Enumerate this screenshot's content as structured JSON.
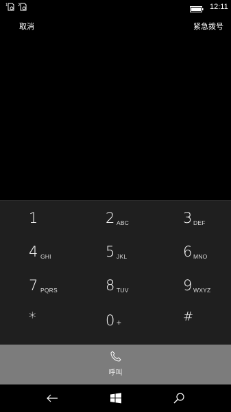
{
  "status_bar": {
    "sim1_icon": "sim-1-icon",
    "sim2_icon": "sim-2-icon",
    "battery_icon": "battery-icon",
    "time": "12:11"
  },
  "top_actions": {
    "cancel_label": "取消",
    "emergency_label": "紧急拨号"
  },
  "keypad": {
    "keys": [
      {
        "digit": "1",
        "letters": ""
      },
      {
        "digit": "2",
        "letters": "ABC"
      },
      {
        "digit": "3",
        "letters": "DEF"
      },
      {
        "digit": "4",
        "letters": "GHI"
      },
      {
        "digit": "5",
        "letters": "JKL"
      },
      {
        "digit": "6",
        "letters": "MNO"
      },
      {
        "digit": "7",
        "letters": "PQRS"
      },
      {
        "digit": "8",
        "letters": "TUV"
      },
      {
        "digit": "9",
        "letters": "WXYZ"
      },
      {
        "digit": "*",
        "letters": ""
      },
      {
        "digit": "0",
        "letters": "+"
      },
      {
        "digit": "#",
        "letters": ""
      }
    ]
  },
  "call": {
    "icon": "phone-icon",
    "label": "呼叫"
  },
  "nav_bar": {
    "back_icon": "back-arrow-icon",
    "start_icon": "windows-logo-icon",
    "search_icon": "search-icon"
  },
  "colors": {
    "background": "#000000",
    "keypad_bg": "#1f1f1f",
    "call_bar_bg": "#7c7c7c",
    "text": "#ffffff"
  }
}
